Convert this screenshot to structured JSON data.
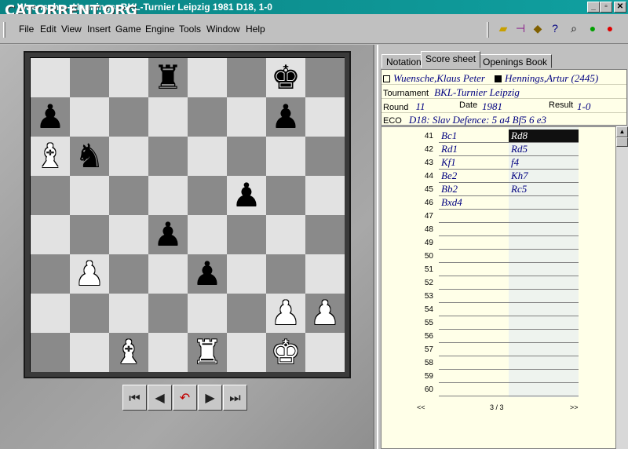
{
  "window": {
    "title": "Wuensche - Hennings, BKL-Turnier Leipzig 1981  D18, 1-0",
    "watermark": "CATORRENT.ORG",
    "btn_min": "_",
    "btn_max": "▫",
    "btn_close": "✕"
  },
  "menu": {
    "items": [
      "File",
      "Edit",
      "View",
      "Insert",
      "Game",
      "Engine",
      "Tools",
      "Window",
      "Help"
    ],
    "toolbar_icons": [
      "folder-icon",
      "insert-line-icon",
      "warning-icon",
      "help-pointer-icon",
      "search-doc-icon",
      "green-check-icon",
      "red-stop-icon"
    ]
  },
  "board": {
    "rows": [
      [
        "",
        "",
        "",
        "bR",
        "",
        "",
        "bK",
        ""
      ],
      [
        "bP",
        "",
        "",
        "",
        "",
        "",
        "bP",
        ""
      ],
      [
        "wB",
        "bN",
        "",
        "",
        "",
        "",
        "",
        ""
      ],
      [
        "",
        "",
        "",
        "",
        "",
        "bP",
        "",
        ""
      ],
      [
        "",
        "",
        "",
        "bP",
        "",
        "",
        "",
        ""
      ],
      [
        "",
        "wP",
        "",
        "",
        "bP",
        "",
        "",
        ""
      ],
      [
        "",
        "",
        "",
        "",
        "",
        "",
        "wP",
        "wP"
      ],
      [
        "",
        "",
        "wB",
        "",
        "wR",
        "",
        "wK",
        ""
      ]
    ],
    "piece_colors": {
      "light_square": "#e2e2e2",
      "dark_square": "#8a8a8a"
    }
  },
  "nav": {
    "first": "⏮",
    "prev": "◀",
    "undo": "↶",
    "next": "▶",
    "last": "⏭"
  },
  "tabs": [
    "Notation",
    "Score sheet",
    "Openings Book"
  ],
  "active_tab": "Score sheet",
  "game": {
    "white_player": "Wuensche,Klaus Peter",
    "black_player": "Hennings,Artur (2445)",
    "tournament_label": "Tournament",
    "tournament": "BKL-Turnier Leipzig",
    "round_label": "Round",
    "round": "11",
    "date_label": "Date",
    "date": "1981",
    "result_label": "Result",
    "result": "1-0",
    "eco_label": "ECO",
    "eco": "D18: Slav Defence: 5 a4 Bf5 6 e3"
  },
  "scoresheet": {
    "rows": [
      {
        "num": "41",
        "white": "Bc1",
        "black": "Rd8",
        "selected": true
      },
      {
        "num": "42",
        "white": "Rd1",
        "black": "Rd5"
      },
      {
        "num": "43",
        "white": "Kf1",
        "black": "f4"
      },
      {
        "num": "44",
        "white": "Be2",
        "black": "Kh7"
      },
      {
        "num": "45",
        "white": "Bb2",
        "black": "Rc5"
      },
      {
        "num": "46",
        "white": "Bxd4",
        "black": ""
      },
      {
        "num": "47",
        "white": "",
        "black": ""
      },
      {
        "num": "48",
        "white": "",
        "black": ""
      },
      {
        "num": "49",
        "white": "",
        "black": ""
      },
      {
        "num": "50",
        "white": "",
        "black": ""
      },
      {
        "num": "51",
        "white": "",
        "black": ""
      },
      {
        "num": "52",
        "white": "",
        "black": ""
      },
      {
        "num": "53",
        "white": "",
        "black": ""
      },
      {
        "num": "54",
        "white": "",
        "black": ""
      },
      {
        "num": "55",
        "white": "",
        "black": ""
      },
      {
        "num": "56",
        "white": "",
        "black": ""
      },
      {
        "num": "57",
        "white": "",
        "black": ""
      },
      {
        "num": "58",
        "white": "",
        "black": ""
      },
      {
        "num": "59",
        "white": "",
        "black": ""
      },
      {
        "num": "60",
        "white": "",
        "black": ""
      }
    ],
    "pager": {
      "prev": "<<",
      "page": "3 / 3",
      "next": ">>"
    }
  }
}
